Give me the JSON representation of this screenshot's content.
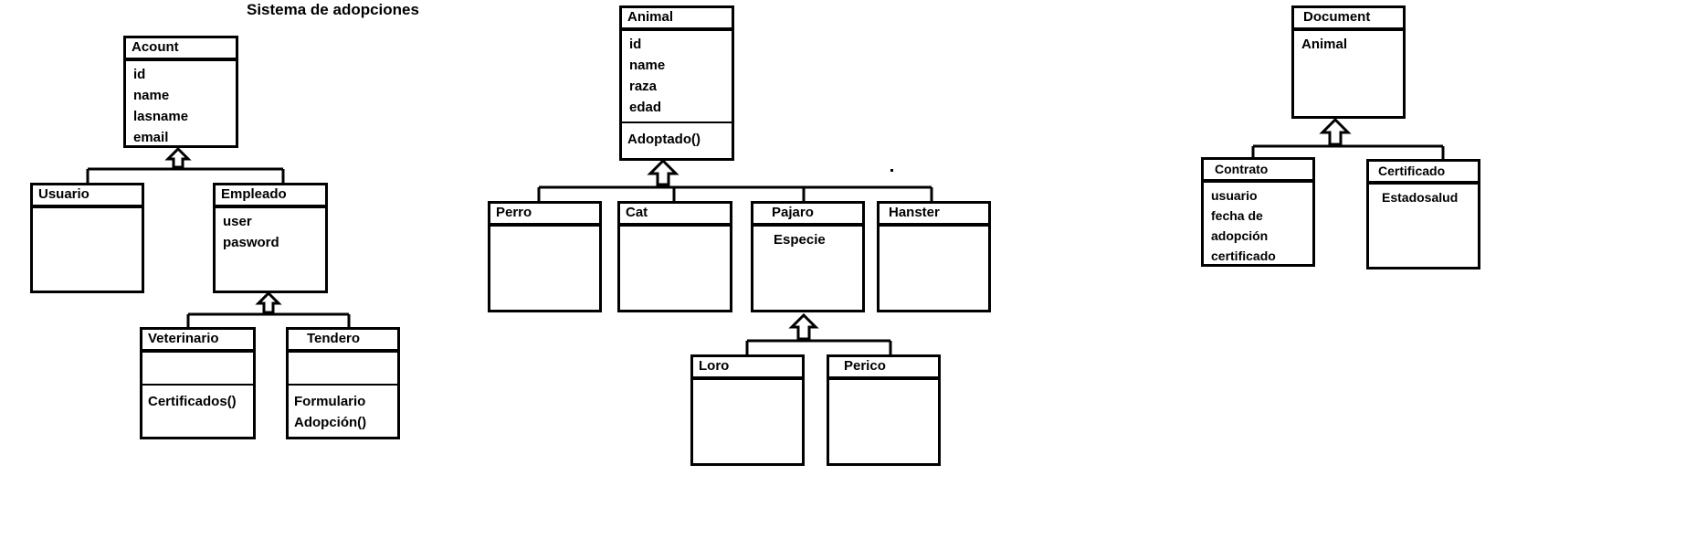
{
  "title": "Sistema de adopciones",
  "classes": {
    "acount": {
      "name": "Acount",
      "attributes": [
        "id",
        "name",
        "lasname",
        "email"
      ]
    },
    "usuario": {
      "name": "Usuario"
    },
    "empleado": {
      "name": "Empleado",
      "attributes": [
        "user",
        "pasword"
      ]
    },
    "veterinario": {
      "name": "Veterinario",
      "methods": [
        "Certificados()"
      ]
    },
    "tendero": {
      "name": "Tendero",
      "methods": [
        "Formulario",
        "Adopción()"
      ]
    },
    "animal": {
      "name": "Animal",
      "attributes": [
        "id",
        "name",
        "raza",
        "edad"
      ],
      "methods": [
        "Adoptado()"
      ]
    },
    "perro": {
      "name": "Perro"
    },
    "cat": {
      "name": "Cat"
    },
    "pajaro": {
      "name": "Pajaro",
      "attributes": [
        "Especie"
      ]
    },
    "hanster": {
      "name": "Hanster"
    },
    "loro": {
      "name": "Loro"
    },
    "perico": {
      "name": "Perico"
    },
    "document": {
      "name": "Document",
      "attributes": [
        "Animal"
      ]
    },
    "contrato": {
      "name": "Contrato",
      "attributes": [
        "usuario",
        "fecha de",
        "adopción",
        "certificado"
      ]
    },
    "certificado": {
      "name": "Certificado",
      "attributes": [
        "Estadosalud"
      ]
    }
  }
}
